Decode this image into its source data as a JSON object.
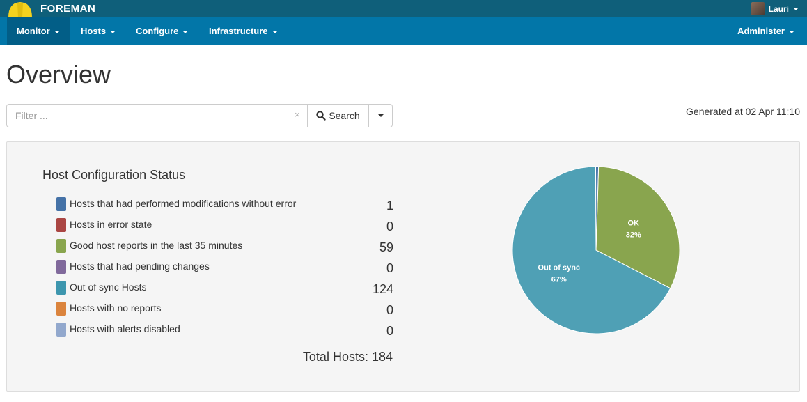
{
  "app": {
    "brand": "FOREMAN"
  },
  "user": {
    "name": "Lauri"
  },
  "nav": {
    "monitor": "Monitor",
    "hosts": "Hosts",
    "configure": "Configure",
    "infrastructure": "Infrastructure",
    "administer": "Administer"
  },
  "page": {
    "title": "Overview",
    "generated": "Generated at 02 Apr 11:10"
  },
  "search": {
    "placeholder": "Filter ...",
    "clear": "×",
    "button": "Search"
  },
  "status_panel": {
    "title": "Host Configuration Status",
    "items": [
      {
        "label": "Hosts that had performed modifications without error",
        "count": "1",
        "color": "#4572a7"
      },
      {
        "label": "Hosts in error state",
        "count": "0",
        "color": "#aa4643"
      },
      {
        "label": "Good host reports in the last 35 minutes",
        "count": "59",
        "color": "#89a54e"
      },
      {
        "label": "Hosts that had pending changes",
        "count": "0",
        "color": "#80699b"
      },
      {
        "label": "Out of sync Hosts",
        "count": "124",
        "color": "#3d96ae"
      },
      {
        "label": "Hosts with no reports",
        "count": "0",
        "color": "#db843d"
      },
      {
        "label": "Hosts with alerts disabled",
        "count": "0",
        "color": "#92a8cd"
      }
    ],
    "total": "Total Hosts: 184"
  },
  "chart_data": {
    "type": "pie",
    "slices": [
      {
        "name": "OK",
        "value": 59,
        "label": "32%",
        "color": "#89a54e"
      },
      {
        "name": "Out of sync",
        "value": 124,
        "label": "67%",
        "color": "#4fa0b5"
      },
      {
        "name": "",
        "value": 1,
        "color": "#4572a7"
      }
    ]
  }
}
